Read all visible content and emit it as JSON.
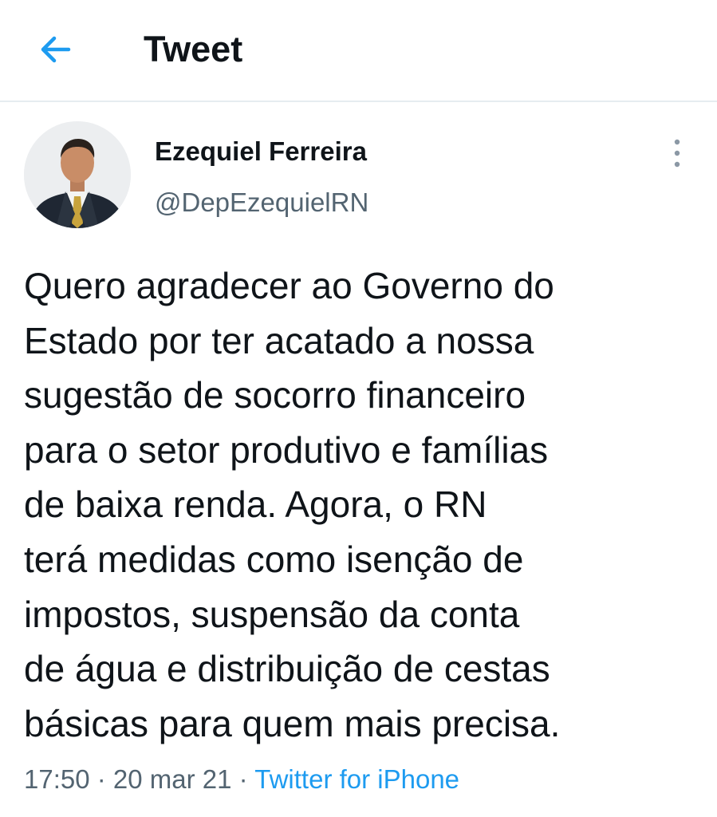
{
  "colors": {
    "accent": "#1d9bf0",
    "text_primary": "#0f1419",
    "text_secondary": "#536471",
    "divider": "#e6ecf0"
  },
  "header": {
    "back_icon": "arrow-left-icon",
    "title": "Tweet"
  },
  "tweet": {
    "author": {
      "name": "Ezequiel Ferreira",
      "handle": "@DepEzequielRN"
    },
    "more_icon": "more-vertical-icon",
    "text": "Quero agradecer ao Governo do\nEstado por ter acatado a nossa\nsugestão de socorro financeiro\npara o setor produtivo e famílias\nde baixa renda. Agora, o RN\nterá medidas como isenção de\nimpostos, suspensão da conta\nde água e distribuição de cestas\nbásicas para quem mais precisa.",
    "time": "17:50",
    "separator": " · ",
    "date": "20 mar 21",
    "source": "Twitter for iPhone"
  }
}
